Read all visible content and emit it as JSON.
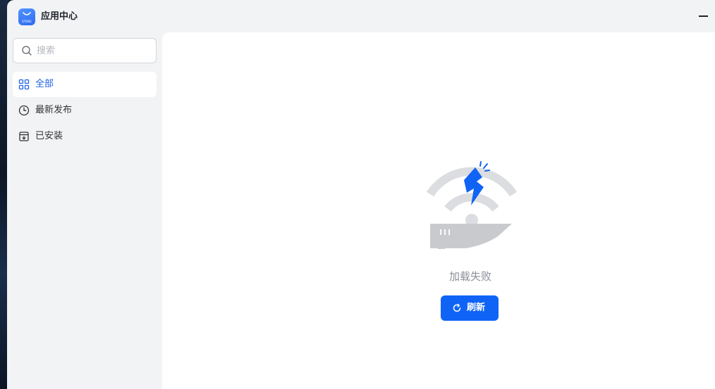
{
  "app": {
    "title": "应用中心",
    "logo_icon": "store-bag-icon",
    "accent_color": "#0f64f5"
  },
  "window_controls": {
    "minimize_icon": "minimize-icon"
  },
  "sidebar": {
    "search": {
      "placeholder": "搜索",
      "value": ""
    },
    "items": [
      {
        "label": "全部",
        "icon": "grid-icon",
        "active": true
      },
      {
        "label": "最新发布",
        "icon": "clock-icon",
        "active": false
      },
      {
        "label": "已安装",
        "icon": "installed-box-icon",
        "active": false
      }
    ]
  },
  "main": {
    "error_illustration": "wifi-disconnected-icon",
    "error_message": "加载失败",
    "refresh_button": {
      "label": "刷新",
      "icon": "refresh-icon"
    }
  }
}
